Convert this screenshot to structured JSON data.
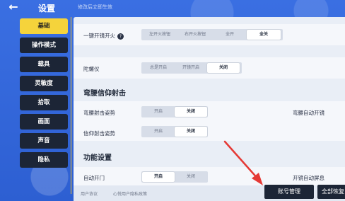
{
  "header": {
    "back_icon": "arrow-left-icon",
    "title": "设置",
    "subtitle": "修改后立即生效"
  },
  "sidebar": {
    "items": [
      {
        "label": "基础",
        "active": true
      },
      {
        "label": "操作模式",
        "active": false
      },
      {
        "label": "载具",
        "active": false
      },
      {
        "label": "灵敏度",
        "active": false
      },
      {
        "label": "拾取",
        "active": false
      },
      {
        "label": "画面",
        "active": false
      },
      {
        "label": "声音",
        "active": false
      },
      {
        "label": "隐私",
        "active": false
      }
    ]
  },
  "settings": {
    "fire_switch": {
      "label": "一键开镜开火",
      "help_icon": "question-icon",
      "options": [
        "左开火按钮",
        "右开火按钮",
        "全开",
        "全关"
      ],
      "selected": "全关"
    },
    "gyro": {
      "label": "陀螺仪",
      "options": [
        "总是开启",
        "开镜开启",
        "关闭"
      ],
      "selected": "关闭"
    },
    "section_belief": "弯腰信仰射击",
    "bend_pose": {
      "label": "弯腰射击姿势",
      "options": [
        "开启",
        "关闭"
      ],
      "selected": "关闭"
    },
    "belief_pose": {
      "label": "信仰射击姿势",
      "options": [
        "开启",
        "关闭"
      ],
      "selected": "关闭"
    },
    "bend_auto_scope": {
      "label": "弯腰自动开镜"
    },
    "section_func": "功能设置",
    "auto_door": {
      "label": "自动开门",
      "options": [
        "开启",
        "关闭"
      ],
      "selected": "开启"
    },
    "scope_screen": {
      "label": "开镜自动屏息"
    }
  },
  "footer": {
    "links": [
      "用户协议",
      "心悦用户隐私政策"
    ],
    "account_button": "账号管理",
    "restore_button": "全部恢复"
  },
  "colors": {
    "accent": "#f5d33b",
    "background": "#2f63d8",
    "sidebar_dark": "#1c2536",
    "panel": "#e9eef6",
    "arrow": "#e53935"
  }
}
